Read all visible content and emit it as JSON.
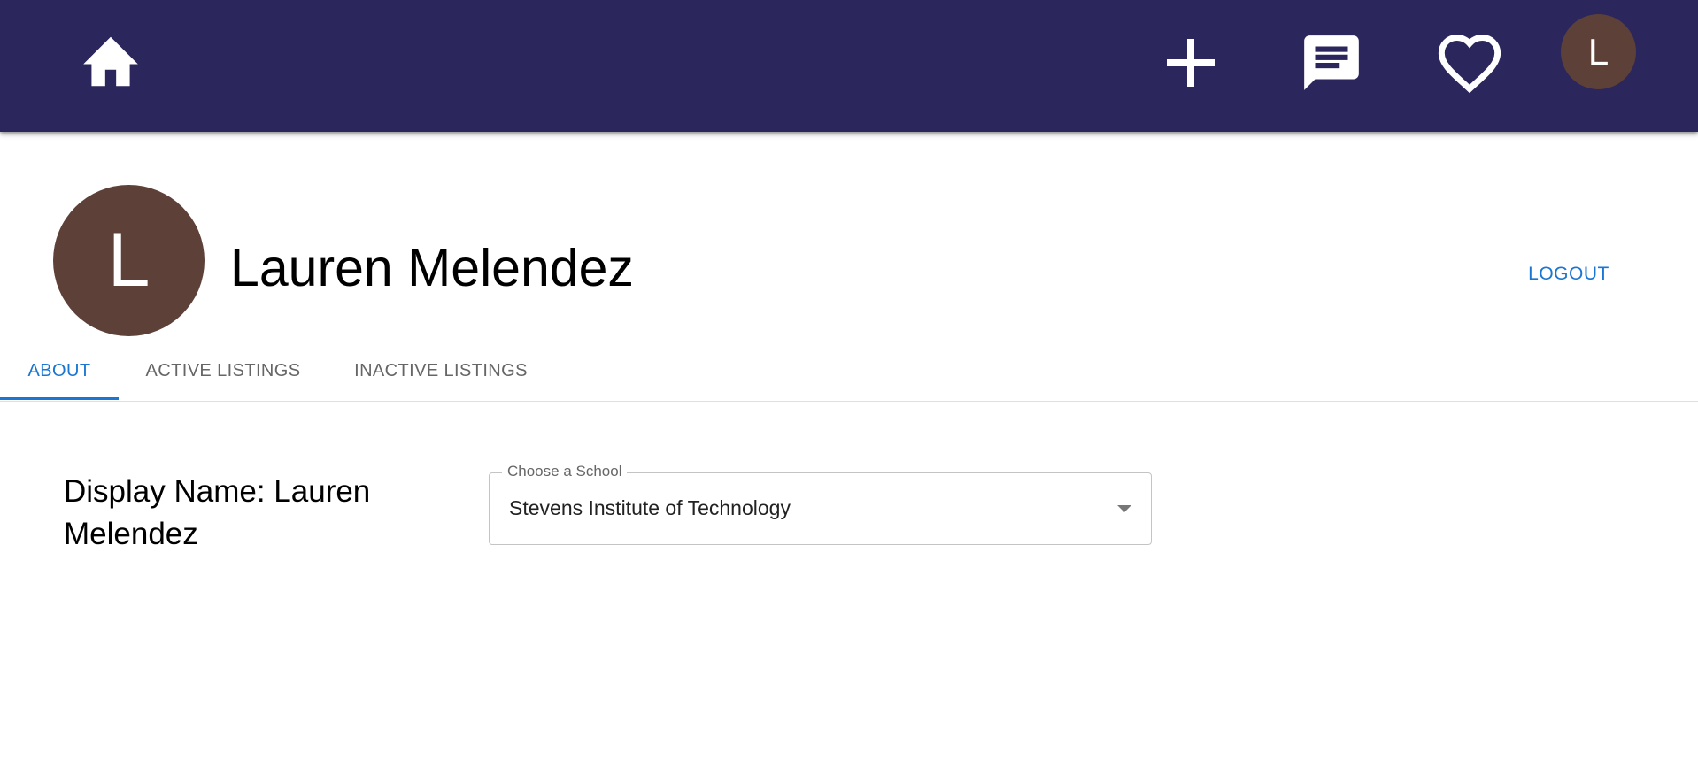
{
  "header": {
    "background": "#2b265b",
    "home_icon": "home-icon",
    "add_icon": "plus-icon",
    "chat_icon": "chat-icon",
    "favorites_icon": "heart-outline-icon",
    "avatar_initial": "L",
    "avatar_color": "#5d4037"
  },
  "profile": {
    "avatar_initial": "L",
    "name": "Lauren Melendez",
    "logout_label": "LOGOUT"
  },
  "tabs": [
    {
      "label": "ABOUT",
      "active": true
    },
    {
      "label": "ACTIVE LISTINGS",
      "active": false
    },
    {
      "label": "INACTIVE LISTINGS",
      "active": false
    }
  ],
  "about": {
    "display_name_text": "Display Name: Lauren Melendez",
    "school_select": {
      "label": "Choose a School",
      "value": "Stevens Institute of Technology"
    }
  },
  "colors": {
    "accent": "#1976d2",
    "avatar": "#5d4037"
  }
}
